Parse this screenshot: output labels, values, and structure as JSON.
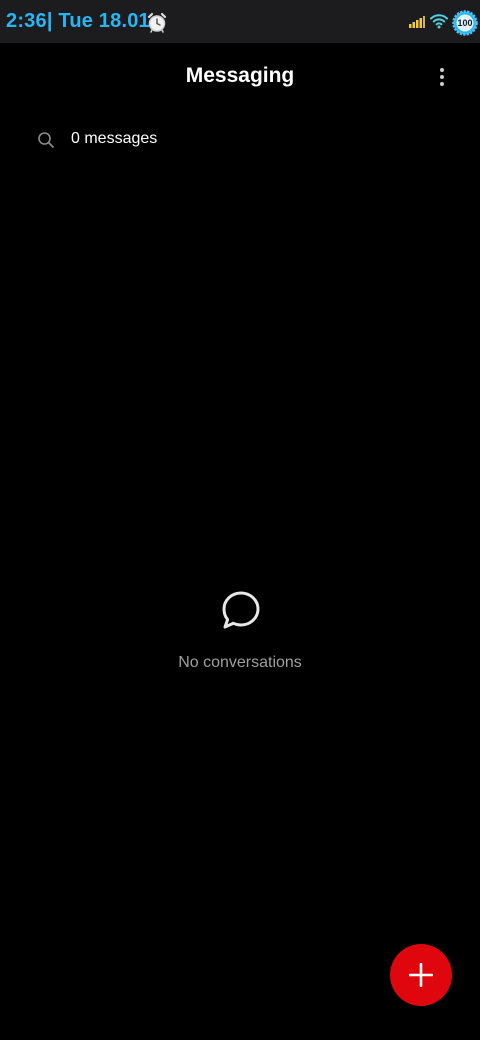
{
  "status_bar": {
    "time": "2:36| Tue 18.01",
    "battery_level": "100",
    "icons": [
      "alarm-clock-icon",
      "signal-icon",
      "wifi-icon",
      "battery-icon"
    ],
    "accent_color": "#29b6f6"
  },
  "header": {
    "title": "Messaging",
    "menu_icon": "more-vertical-icon"
  },
  "search": {
    "icon": "search-icon",
    "label": "0 messages"
  },
  "empty_state": {
    "icon": "chat-bubble-icon",
    "text": "No conversations"
  },
  "fab": {
    "icon": "plus-icon",
    "color": "#e0060e"
  }
}
